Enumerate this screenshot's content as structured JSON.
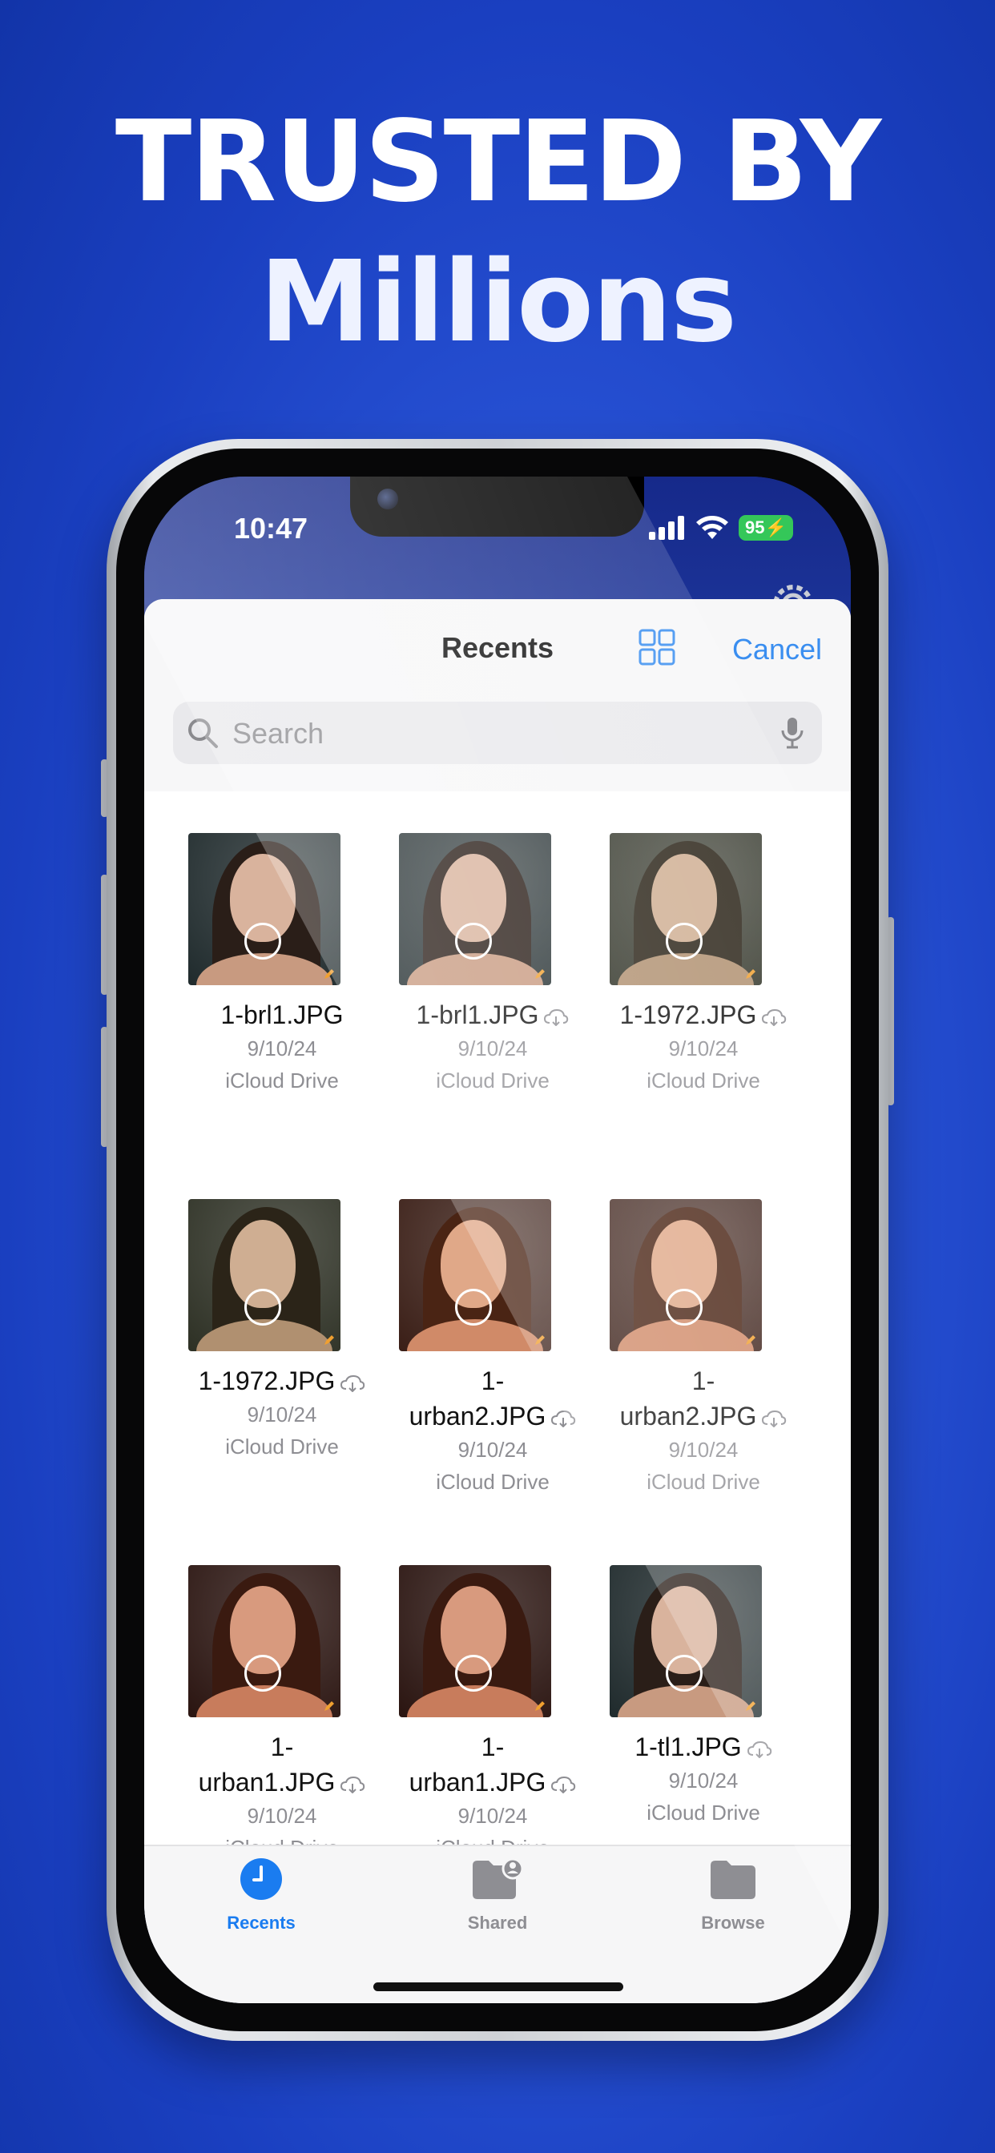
{
  "headline": {
    "line1": "TRUSTED BY",
    "line2": "Millions"
  },
  "status_bar": {
    "time": "10:47",
    "battery": "95"
  },
  "sheet": {
    "title": "Recents",
    "cancel_label": "Cancel"
  },
  "search": {
    "placeholder": "Search",
    "value": ""
  },
  "files": [
    {
      "name_line1": "",
      "name_line2": "1-brl1.JPG",
      "cloud": false,
      "date": "9/10/24",
      "location": "iCloud Drive",
      "tone": "cool"
    },
    {
      "name_line1": "",
      "name_line2": "1-brl1.JPG",
      "cloud": true,
      "date": "9/10/24",
      "location": "iCloud Drive",
      "tone": "cool"
    },
    {
      "name_line1": "",
      "name_line2": "1-1972.JPG",
      "cloud": true,
      "date": "9/10/24",
      "location": "iCloud Drive",
      "tone": "olive"
    },
    {
      "name_line1": "",
      "name_line2": "1-1972.JPG",
      "cloud": true,
      "date": "9/10/24",
      "location": "iCloud Drive",
      "tone": "olive"
    },
    {
      "name_line1": "1-",
      "name_line2": "urban2.JPG",
      "cloud": true,
      "date": "9/10/24",
      "location": "iCloud Drive",
      "tone": "warm"
    },
    {
      "name_line1": "1-",
      "name_line2": "urban2.JPG",
      "cloud": true,
      "date": "9/10/24",
      "location": "iCloud Drive",
      "tone": "warm"
    },
    {
      "name_line1": "1-",
      "name_line2": "urban1.JPG",
      "cloud": true,
      "date": "9/10/24",
      "location": "iCloud Drive",
      "tone": "red"
    },
    {
      "name_line1": "1-",
      "name_line2": "urban1.JPG",
      "cloud": true,
      "date": "9/10/24",
      "location": "iCloud Drive",
      "tone": "red"
    },
    {
      "name_line1": "",
      "name_line2": "1-tl1.JPG",
      "cloud": true,
      "date": "9/10/24",
      "location": "iCloud Drive",
      "tone": "cool"
    }
  ],
  "tabs": [
    {
      "label": "Recents",
      "icon": "clock-icon",
      "active": true
    },
    {
      "label": "Shared",
      "icon": "shared-folder-icon",
      "active": false
    },
    {
      "label": "Browse",
      "icon": "folder-icon",
      "active": false
    }
  ],
  "colors": {
    "accent": "#1a7cf0",
    "cancel": "#3a8ef0",
    "background": "#2a55d8",
    "inactive_tab": "#8e8e93"
  }
}
